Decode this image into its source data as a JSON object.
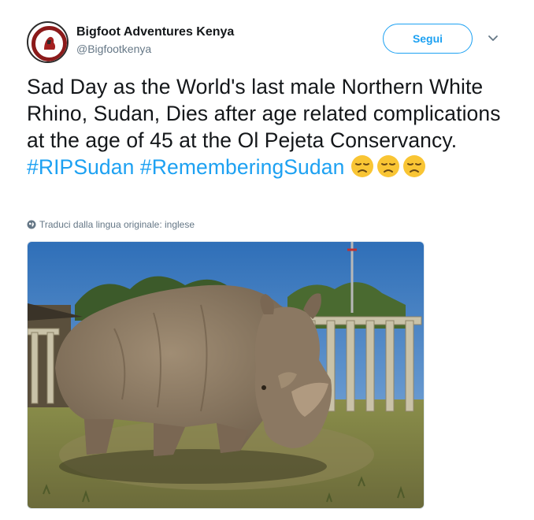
{
  "tweet": {
    "display_name": "Bigfoot Adventures Kenya",
    "handle": "@Bigfootkenya",
    "follow_label": "Segui",
    "text_plain_1": "Sad Day as the World's last male Northern White Rhino, Sudan, Dies after age related complications at the age of 45 at the Ol Pejeta Conservancy. ",
    "hashtag_1": "#RIPSudan",
    "hashtag_2": "#RememberingSudan",
    "translate_label": "Traduci dalla lingua originale: inglese"
  },
  "colors": {
    "link_blue": "#1da1f2",
    "muted_gray": "#657786",
    "text_dark": "#14171a"
  },
  "icons": {
    "caret": "chevron-down-icon",
    "translate": "globe-icon",
    "emoji": "disappointed-face-emoji"
  }
}
